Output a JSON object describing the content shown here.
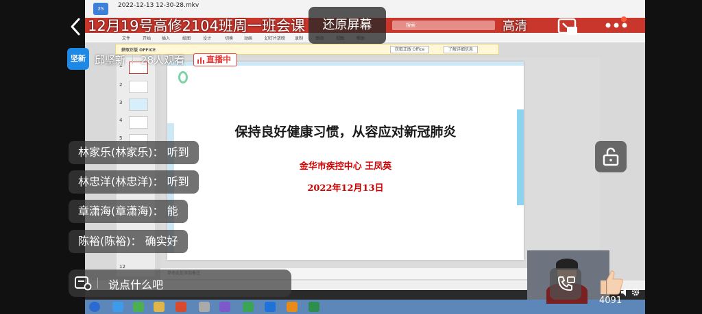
{
  "header": {
    "room_title": "12月19号高修2104班周一班会课",
    "restore_button": "还原屏幕",
    "quality": "高清"
  },
  "host": {
    "avatar_text": "坚新",
    "name": "邱坚新",
    "viewers": "28人观看",
    "live_badge": "直播中"
  },
  "chat": {
    "messages": [
      {
        "text": "林家乐(林家乐)： 听到"
      },
      {
        "text": "林忠洋(林忠洋)： 听到"
      },
      {
        "text": "章潇海(章潇海)： 能"
      },
      {
        "text": "陈裕(陈裕)： 确实好"
      }
    ],
    "input_placeholder": "说点什么吧"
  },
  "likes": {
    "count": "4091"
  },
  "video": {
    "file_title": "2022-12-13 12-30-28.mkv",
    "ribbon_search": "搜索",
    "ribbon_tabs": [
      "文件",
      "开始",
      "插入",
      "绘图",
      "设计",
      "切换",
      "动画",
      "幻灯片放映",
      "录制",
      "审阅",
      "视图",
      "帮助"
    ],
    "notice_title": "获取正版 OFFICE",
    "notice_btn1": "获取正版 Office",
    "notice_btn2": "了解详细信息",
    "slide_numbers": [
      "1",
      "2",
      "3",
      "4",
      "5",
      "12"
    ],
    "notes_placeholder": "单击此处添加备注",
    "slide": {
      "title": "保持良好健康习惯，从容应对新冠肺炎",
      "subtitle": "金华市疾控中心    王凤英",
      "date": "2022年12月13日"
    }
  },
  "colors": {
    "ribbon_red": "#c8362c",
    "live_red": "#e53935",
    "avatar_blue": "#1e88e5",
    "slide_red": "#d10000"
  }
}
